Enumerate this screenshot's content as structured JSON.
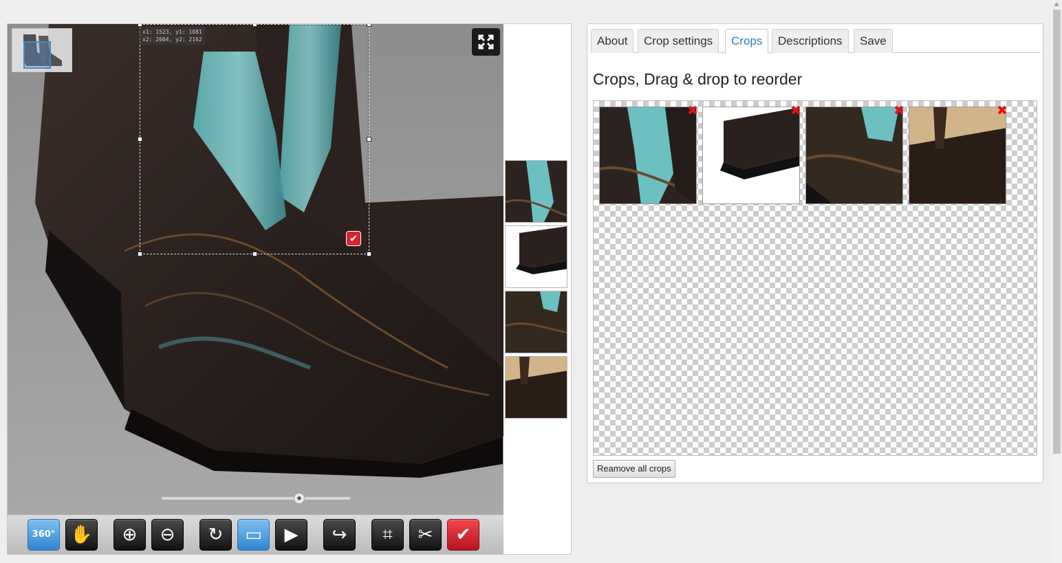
{
  "viewer": {
    "crop_coords_line1": "x1: 1523, y1: 1081",
    "crop_coords_line2": "x2: 2604, y2: 2162",
    "zoom_level": 0.73,
    "icons": [
      "fullscreen-icon",
      "checkmark-icon",
      "zoom-slider-knob-icon"
    ],
    "toolbar": [
      {
        "name": "360-button",
        "label": "360°",
        "style": "blue"
      },
      {
        "name": "pan-button",
        "glyph": "✋",
        "style": "dark"
      },
      {
        "name": "zoom-in-button",
        "glyph": "⊕",
        "style": "dark"
      },
      {
        "name": "zoom-out-button",
        "glyph": "⊖",
        "style": "dark"
      },
      {
        "name": "reset-button",
        "glyph": "↻",
        "style": "dark"
      },
      {
        "name": "fit-screen-button",
        "glyph": "▭",
        "style": "blue"
      },
      {
        "name": "play-button",
        "glyph": "▶",
        "style": "dark"
      },
      {
        "name": "redo-button",
        "glyph": "↪",
        "style": "dark"
      },
      {
        "name": "crop-button",
        "glyph": "⌗",
        "style": "dark"
      },
      {
        "name": "settings-button",
        "glyph": "✂",
        "style": "dark"
      },
      {
        "name": "confirm-button",
        "glyph": "✔",
        "style": "red"
      }
    ]
  },
  "panel": {
    "tabs": [
      "About",
      "Crop settings",
      "Crops",
      "Descriptions",
      "Save"
    ],
    "active_tab": "Crops",
    "title": "Crops, Drag & drop to reorder",
    "crop_count": 4,
    "remove_all_label": "Reamove all crops"
  },
  "colors": {
    "accent": "#2f7fc0",
    "delete": "#e0141c",
    "confirm": "#d9232d",
    "toolbar_blue": "#3d8bd6"
  }
}
